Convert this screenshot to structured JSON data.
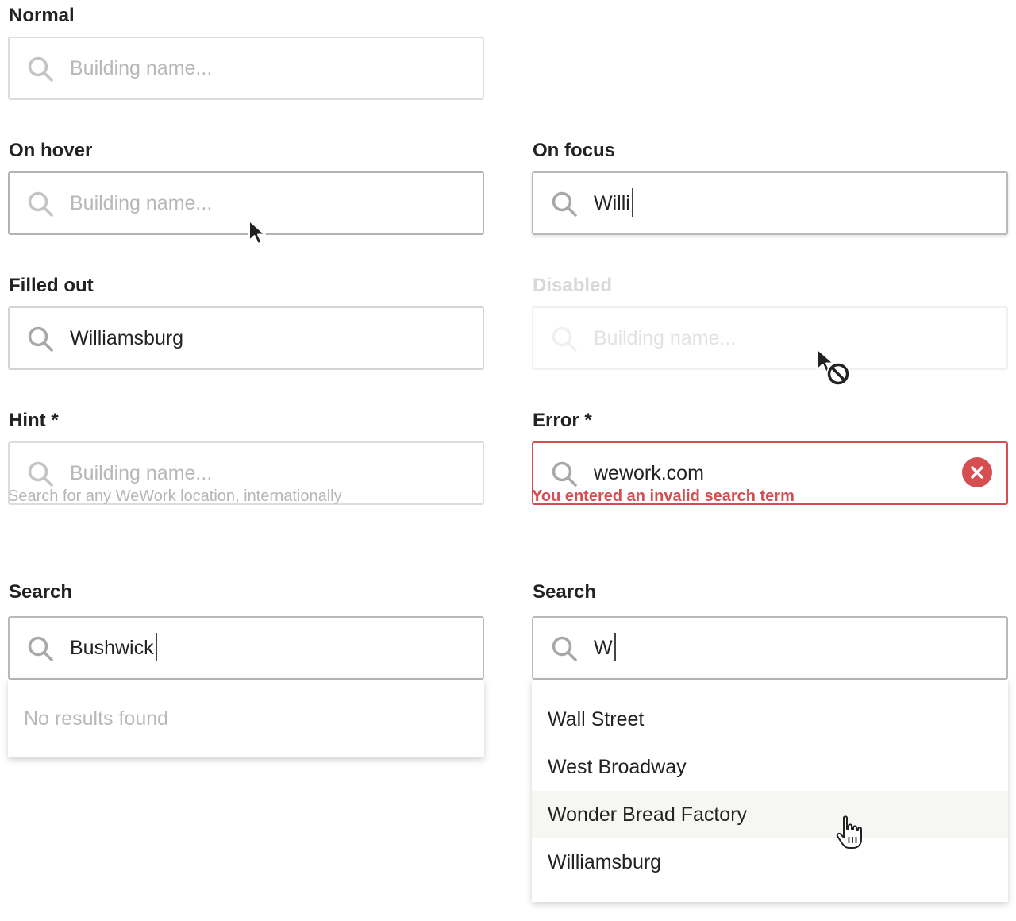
{
  "normal": {
    "label": "Normal",
    "placeholder": "Building name..."
  },
  "hover": {
    "label": "On hover",
    "placeholder": "Building name..."
  },
  "focus": {
    "label": "On focus",
    "value": "Willi"
  },
  "filled": {
    "label": "Filled out",
    "value": "Williamsburg"
  },
  "disabled": {
    "label": "Disabled",
    "placeholder": "Building name..."
  },
  "hint": {
    "label": "Hint *",
    "placeholder": "Building name...",
    "help": "Search for any WeWork location, internationally"
  },
  "error": {
    "label": "Error *",
    "value": "wework.com",
    "message": "You entered an invalid search term"
  },
  "search_empty": {
    "label": "Search",
    "value": "Bushwick",
    "no_results": "No results found"
  },
  "search_results": {
    "label": "Search",
    "value": "W",
    "options": [
      "Wall Street",
      "West Broadway",
      "Wonder Bread Factory",
      "Williamsburg"
    ],
    "highlighted_option": "Wonder Bread Factory"
  },
  "icons": {
    "field_icon": "search-icon",
    "clear_icon": "clear-icon",
    "cursors": [
      "arrow-cursor-icon",
      "not-allowed-cursor-icon",
      "hand-pointer-cursor-icon"
    ]
  },
  "colors": {
    "text": "#222222",
    "placeholder": "#b8b8b8",
    "border": "#dcdcdc",
    "error": "#d44e52",
    "highlight": "#f6f6f2"
  }
}
